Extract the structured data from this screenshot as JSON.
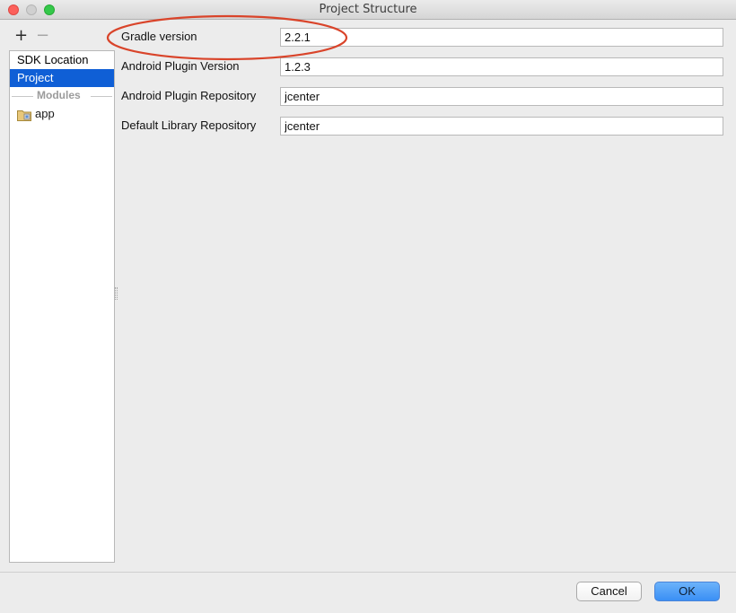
{
  "window": {
    "title": "Project Structure"
  },
  "toolbar": {
    "add_label": "+",
    "remove_label": "−"
  },
  "sidebar": {
    "items": [
      {
        "label": "SDK Location",
        "selected": false
      },
      {
        "label": "Project",
        "selected": true
      }
    ],
    "modules_header": "Modules",
    "modules": [
      {
        "label": "app",
        "icon": "folder-module-icon"
      }
    ]
  },
  "form": {
    "fields": [
      {
        "label": "Gradle version",
        "value": "2.2.1"
      },
      {
        "label": "Android Plugin Version",
        "value": "1.2.3"
      },
      {
        "label": "Android Plugin Repository",
        "value": "jcenter"
      },
      {
        "label": "Default Library Repository",
        "value": "jcenter"
      }
    ]
  },
  "footer": {
    "cancel_label": "Cancel",
    "ok_label": "OK"
  },
  "colors": {
    "selection": "#0f5fd6",
    "annotation": "#d9442a",
    "ok_button": "#3a8ff5"
  }
}
